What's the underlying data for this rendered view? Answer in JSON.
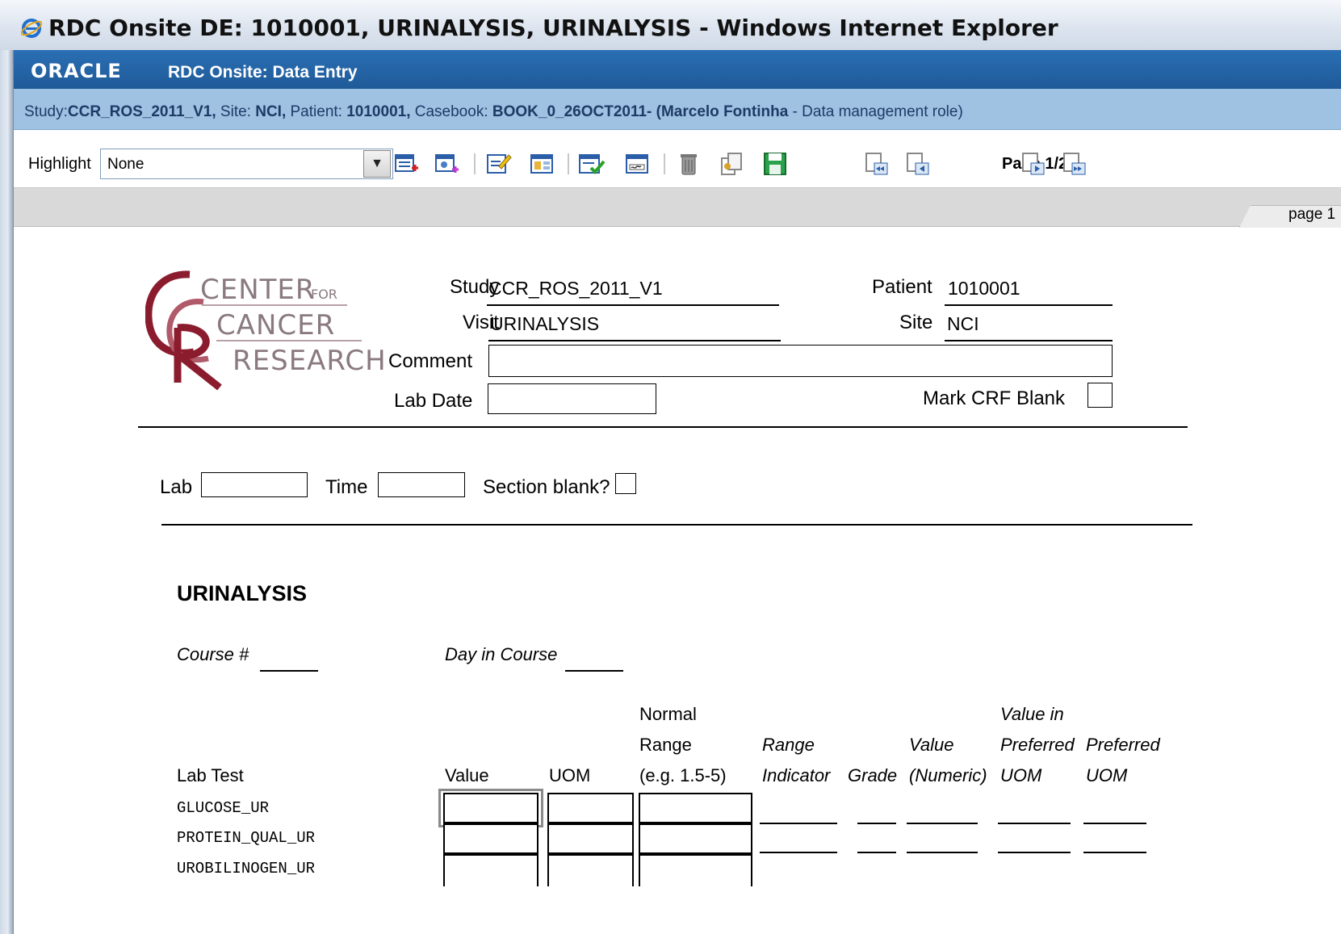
{
  "window": {
    "title": "RDC Onsite DE: 1010001, URINALYSIS, URINALYSIS - Windows Internet Explorer"
  },
  "header": {
    "brand": "ORACLE",
    "app_title": "RDC Onsite: Data Entry"
  },
  "context": {
    "study_label": "Study:",
    "study": "CCR_ROS_2011_V1,",
    "site_label": " Site: ",
    "site": "NCI,",
    "patient_label": " Patient: ",
    "patient": "1010001,",
    "casebook_label": " Casebook: ",
    "casebook": "BOOK_0_26OCT2011- (Marcelo Fontinha",
    "role": " - Data management role)"
  },
  "toolbar": {
    "highlight_label": "Highlight",
    "highlight_value": "None",
    "page_indicator": "Page 1/2"
  },
  "tabs": {
    "page_tab": "page 1"
  },
  "logo": {
    "line1": "CENTER",
    "line1b": "FOR",
    "line2": "CANCER",
    "line3": "RESEARCH"
  },
  "form_header": {
    "study_label": "Study",
    "study_value": "CCR_ROS_2011_V1",
    "visit_label": "Visit",
    "visit_value": "URINALYSIS",
    "patient_label": "Patient",
    "patient_value": "1010001",
    "site_label": "Site",
    "site_value": "NCI",
    "comment_label": "Comment",
    "lab_date_label": "Lab Date",
    "mark_blank_label": "Mark CRF Blank"
  },
  "section": {
    "lab_label": "Lab",
    "time_label": "Time",
    "section_blank_label": "Section blank?",
    "title": "URINALYSIS",
    "course_label": "Course #",
    "day_label": "Day in Course"
  },
  "table": {
    "col_lab_test": "Lab Test",
    "col_value": "Value",
    "col_uom": "UOM",
    "col_normal_1": "Normal",
    "col_normal_2": "Range",
    "col_normal_3": "(e.g. 1.5-5)",
    "col_range_1": "Range",
    "col_range_2": "Indicator",
    "col_grade": "Grade",
    "col_valnum_1": "Value",
    "col_valnum_2": "(Numeric)",
    "col_pref_val_1": "Value in",
    "col_pref_val_2": "Preferred",
    "col_pref_val_3": "UOM",
    "col_pref_uom_1": "Preferred",
    "col_pref_uom_2": "UOM",
    "rows": [
      "GLUCOSE_UR",
      "PROTEIN_QUAL_UR",
      "UROBILINOGEN_UR"
    ]
  }
}
